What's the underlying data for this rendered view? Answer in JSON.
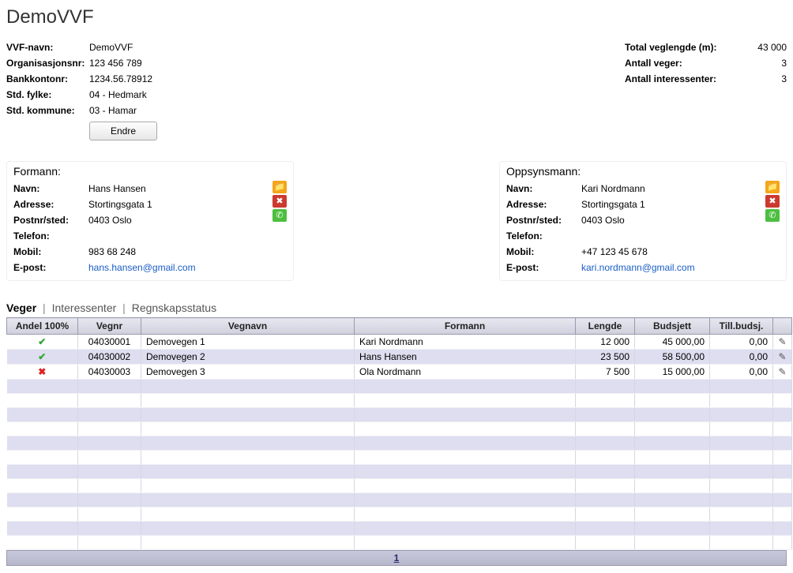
{
  "title": "DemoVVF",
  "info": {
    "vvf_navn_label": "VVF-navn:",
    "vvf_navn": "DemoVVF",
    "orgnr_label": "Organisasjonsnr:",
    "orgnr": "123 456 789",
    "bank_label": "Bankkontonr:",
    "bank": "1234.56.78912",
    "fylke_label": "Std. fylke:",
    "fylke": "04 - Hedmark",
    "kommune_label": "Std. kommune:",
    "kommune": "03 - Hamar"
  },
  "totals": {
    "veglengde_label": "Total veglengde (m):",
    "veglengde": "43 000",
    "veger_label": "Antall veger:",
    "veger": "3",
    "interessenter_label": "Antall interessenter:",
    "interessenter": "3"
  },
  "btn_endre": "Endre",
  "formann": {
    "title": "Formann:",
    "navn_label": "Navn:",
    "navn": "Hans Hansen",
    "adresse_label": "Adresse:",
    "adresse": "Stortingsgata 1",
    "postnr_label": "Postnr/sted:",
    "postnr": "0403 Oslo",
    "telefon_label": "Telefon:",
    "telefon": "",
    "mobil_label": "Mobil:",
    "mobil": "983 68 248",
    "epost_label": "E-post:",
    "epost": "hans.hansen@gmail.com"
  },
  "oppsyn": {
    "title": "Oppsynsmann:",
    "navn_label": "Navn:",
    "navn": "Kari Nordmann",
    "adresse_label": "Adresse:",
    "adresse": "Stortingsgata 1",
    "postnr_label": "Postnr/sted:",
    "postnr": "0403 Oslo",
    "telefon_label": "Telefon:",
    "telefon": "",
    "mobil_label": "Mobil:",
    "mobil": "+47 123 45 678",
    "epost_label": "E-post:",
    "epost": "kari.nordmann@gmail.com"
  },
  "tabs": {
    "veger": "Veger",
    "interessenter": "Interessenter",
    "regnskap": "Regnskapsstatus"
  },
  "headers": {
    "andel": "Andel 100%",
    "vegnr": "Vegnr",
    "vegnavn": "Vegnavn",
    "formann": "Formann",
    "lengde": "Lengde",
    "budsjett": "Budsjett",
    "till": "Till.budsj."
  },
  "rows": [
    {
      "ok": true,
      "vegnr": "04030001",
      "vegnavn": "Demovegen 1",
      "formann": "Kari Nordmann",
      "lengde": "12 000",
      "budsjett": "45 000,00",
      "till": "0,00"
    },
    {
      "ok": true,
      "vegnr": "04030002",
      "vegnavn": "Demovegen 2",
      "formann": "Hans Hansen",
      "lengde": "23 500",
      "budsjett": "58 500,00",
      "till": "0,00"
    },
    {
      "ok": false,
      "vegnr": "04030003",
      "vegnavn": "Demovegen 3",
      "formann": "Ola Nordmann",
      "lengde": "7 500",
      "budsjett": "15 000,00",
      "till": "0,00"
    }
  ],
  "pager": "1"
}
